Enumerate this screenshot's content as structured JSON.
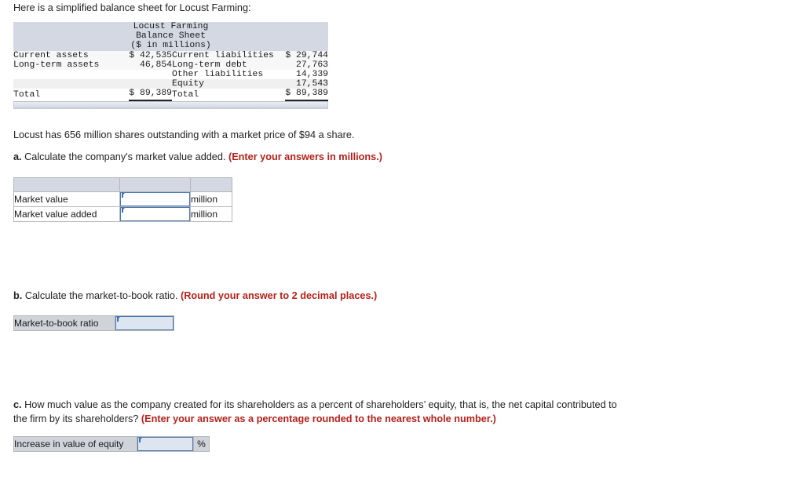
{
  "intro": {
    "text": "Here is a simplified balance sheet for Locust Farming:"
  },
  "balance_sheet": {
    "title_line1": "Locust Farming",
    "title_line2": "Balance Sheet",
    "title_line3": "($ in millions)",
    "rows": [
      {
        "asset_label": "Current assets",
        "asset_value": "$ 42,535",
        "liability_label": "Current liabilities",
        "liability_value": "$ 29,744"
      },
      {
        "asset_label": "Long-term assets",
        "asset_value": "46,854",
        "liability_label": "Long-term debt",
        "liability_value": "27,763"
      },
      {
        "asset_label": "",
        "asset_value": "",
        "liability_label": "Other liabilities",
        "liability_value": "14,339"
      },
      {
        "asset_label": "",
        "asset_value": "",
        "liability_label": "Equity",
        "liability_value": "17,543"
      }
    ],
    "total": {
      "asset_label": "Total",
      "asset_value": "$ 89,389",
      "liability_label": "Total",
      "liability_value": "$ 89,389"
    }
  },
  "shares_note": {
    "text": "Locust has 656 million shares outstanding with a market price of $94 a share.",
    "shares_outstanding_millions": 656,
    "market_price_per_share": 94
  },
  "question_a": {
    "label": "a.",
    "text": "Calculate the company's market value added.",
    "instruction": "(Enter your answers in millions.)",
    "table": {
      "header": [
        "",
        "",
        ""
      ],
      "rows": [
        {
          "label": "Market value",
          "value": "",
          "unit": "million"
        },
        {
          "label": "Market value added",
          "value": "",
          "unit": "million"
        }
      ]
    }
  },
  "question_b": {
    "label": "b.",
    "text": "Calculate the market-to-book ratio.",
    "instruction": "(Round your answer to 2 decimal places.)",
    "table": {
      "rows": [
        {
          "label": "Market-to-book ratio",
          "value": ""
        }
      ]
    }
  },
  "question_c": {
    "label": "c.",
    "text": "How much value as the company created for its shareholders as a percent of shareholders’ equity, that is, the net capital contributed to the firm by its shareholders?",
    "instruction": "(Enter your answer as a percentage rounded to the nearest whole number.)",
    "table": {
      "rows": [
        {
          "label": "Increase in value of equity",
          "value": "",
          "unit": "%"
        }
      ]
    }
  },
  "colors": {
    "header_bg": "#d3d8e2",
    "label_bg": "#d0d3da",
    "emphasis_red": "#b3221b",
    "field_border": "#4a78b5",
    "field_tint": "#dde5f0"
  }
}
